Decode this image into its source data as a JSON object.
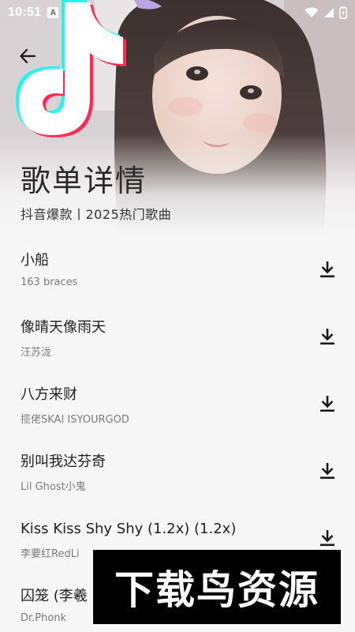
{
  "status_bar": {
    "time": "10:51",
    "notification_letter": "A"
  },
  "header": {
    "title": "歌单详情",
    "subtitle": "抖音爆款丨2025热门歌曲"
  },
  "songs": [
    {
      "title": "小船",
      "artist": "163 braces"
    },
    {
      "title": "像晴天像雨天",
      "artist": "汪苏泷"
    },
    {
      "title": "八方来财",
      "artist": "揽佬SKAI ISYOURGOD"
    },
    {
      "title": "别叫我达芬奇",
      "artist": "Lil Ghost小鬼"
    },
    {
      "title": "Kiss Kiss Shy Shy (1.2x) (1.2x)",
      "artist": "李要红RedLi"
    },
    {
      "title": "囚笼 (李羲",
      "artist": "Dr.Phonk"
    }
  ],
  "watermark": {
    "text": "下载鸟资源"
  },
  "colors": {
    "background": "#f7f7f8",
    "title_text": "#2a2a2a",
    "artist_text": "#7a7a7a",
    "tiktok_cyan": "#25f4ee",
    "tiktok_pink": "#fe2c55"
  }
}
